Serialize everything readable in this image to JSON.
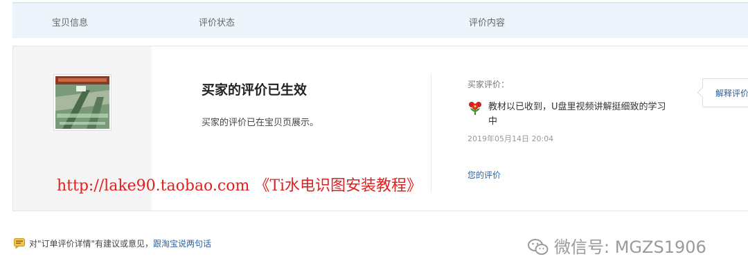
{
  "table_header": {
    "col_item": "宝贝信息",
    "col_status": "评价状态",
    "col_content": "评价内容"
  },
  "order": {
    "status_title": "买家的评价已生效",
    "status_desc": "买家的评价已在宝贝页展示。",
    "review_label": "买家评价：",
    "review_text": "教材以已收到，U盘里视频讲解挺细致的学习中",
    "review_date": "2019年05月14日 20:04",
    "my_review_link": "您的评价",
    "explain_button": "解释评价"
  },
  "watermark": {
    "url_text": "http://lake90.taobao.com  《Ti水电识图安装教程》",
    "color": "#e02020"
  },
  "footer": {
    "feedback_text": "对\"订单评价详情\"有建议或意见，",
    "feedback_link": "跟淘宝说两句话"
  },
  "wechat_id": "微信号: MGZS1906",
  "colors": {
    "header_bg": "#eef4fb",
    "link": "#2a5f9e",
    "left_pane_bg": "#f5f5f5"
  }
}
